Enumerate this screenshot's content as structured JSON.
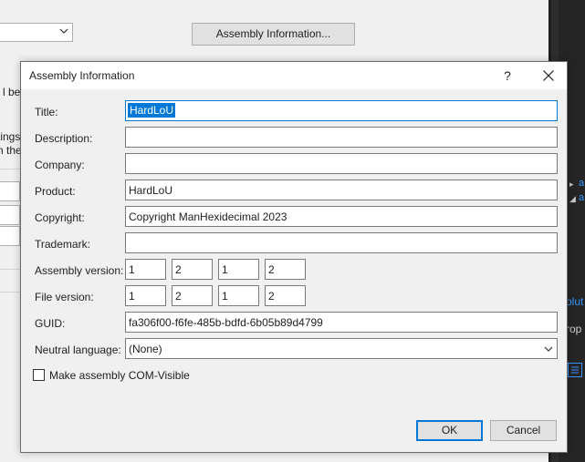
{
  "background": {
    "assembly_info_button": "Assembly Information...",
    "fragments": [
      "l be r",
      "tings",
      "n the"
    ]
  },
  "ide": {
    "solution_label": "olut",
    "properties_label": "rop",
    "markers": [
      "▸",
      "◢"
    ],
    "glyphs": [
      "a",
      "a"
    ]
  },
  "dialog": {
    "title": "Assembly Information",
    "help_label": "?",
    "fields": {
      "title": {
        "label": "Title:",
        "value": "HardLoU"
      },
      "description": {
        "label": "Description:",
        "value": ""
      },
      "company": {
        "label": "Company:",
        "value": ""
      },
      "product": {
        "label": "Product:",
        "value": "HardLoU"
      },
      "copyright": {
        "label": "Copyright:",
        "value": "Copyright ManHexidecimal 2023"
      },
      "trademark": {
        "label": "Trademark:",
        "value": ""
      },
      "assembly_version": {
        "label": "Assembly version:",
        "parts": [
          "1",
          "2",
          "1",
          "2"
        ]
      },
      "file_version": {
        "label": "File version:",
        "parts": [
          "1",
          "2",
          "1",
          "2"
        ]
      },
      "guid": {
        "label": "GUID:",
        "value": "fa306f00-f6fe-485b-bdfd-6b05b89d4799"
      },
      "neutral_language": {
        "label": "Neutral language:",
        "value": "(None)"
      }
    },
    "com_visible": {
      "label": "Make assembly COM-Visible",
      "checked": false
    },
    "ok_label": "OK",
    "cancel_label": "Cancel"
  },
  "icons": {
    "close": "close-icon",
    "dropdown": "chevron-down-icon"
  },
  "colors": {
    "accent": "#0078d7",
    "dialog_bg": "#f0f0f0",
    "ide_dark": "#1e1e1e"
  }
}
